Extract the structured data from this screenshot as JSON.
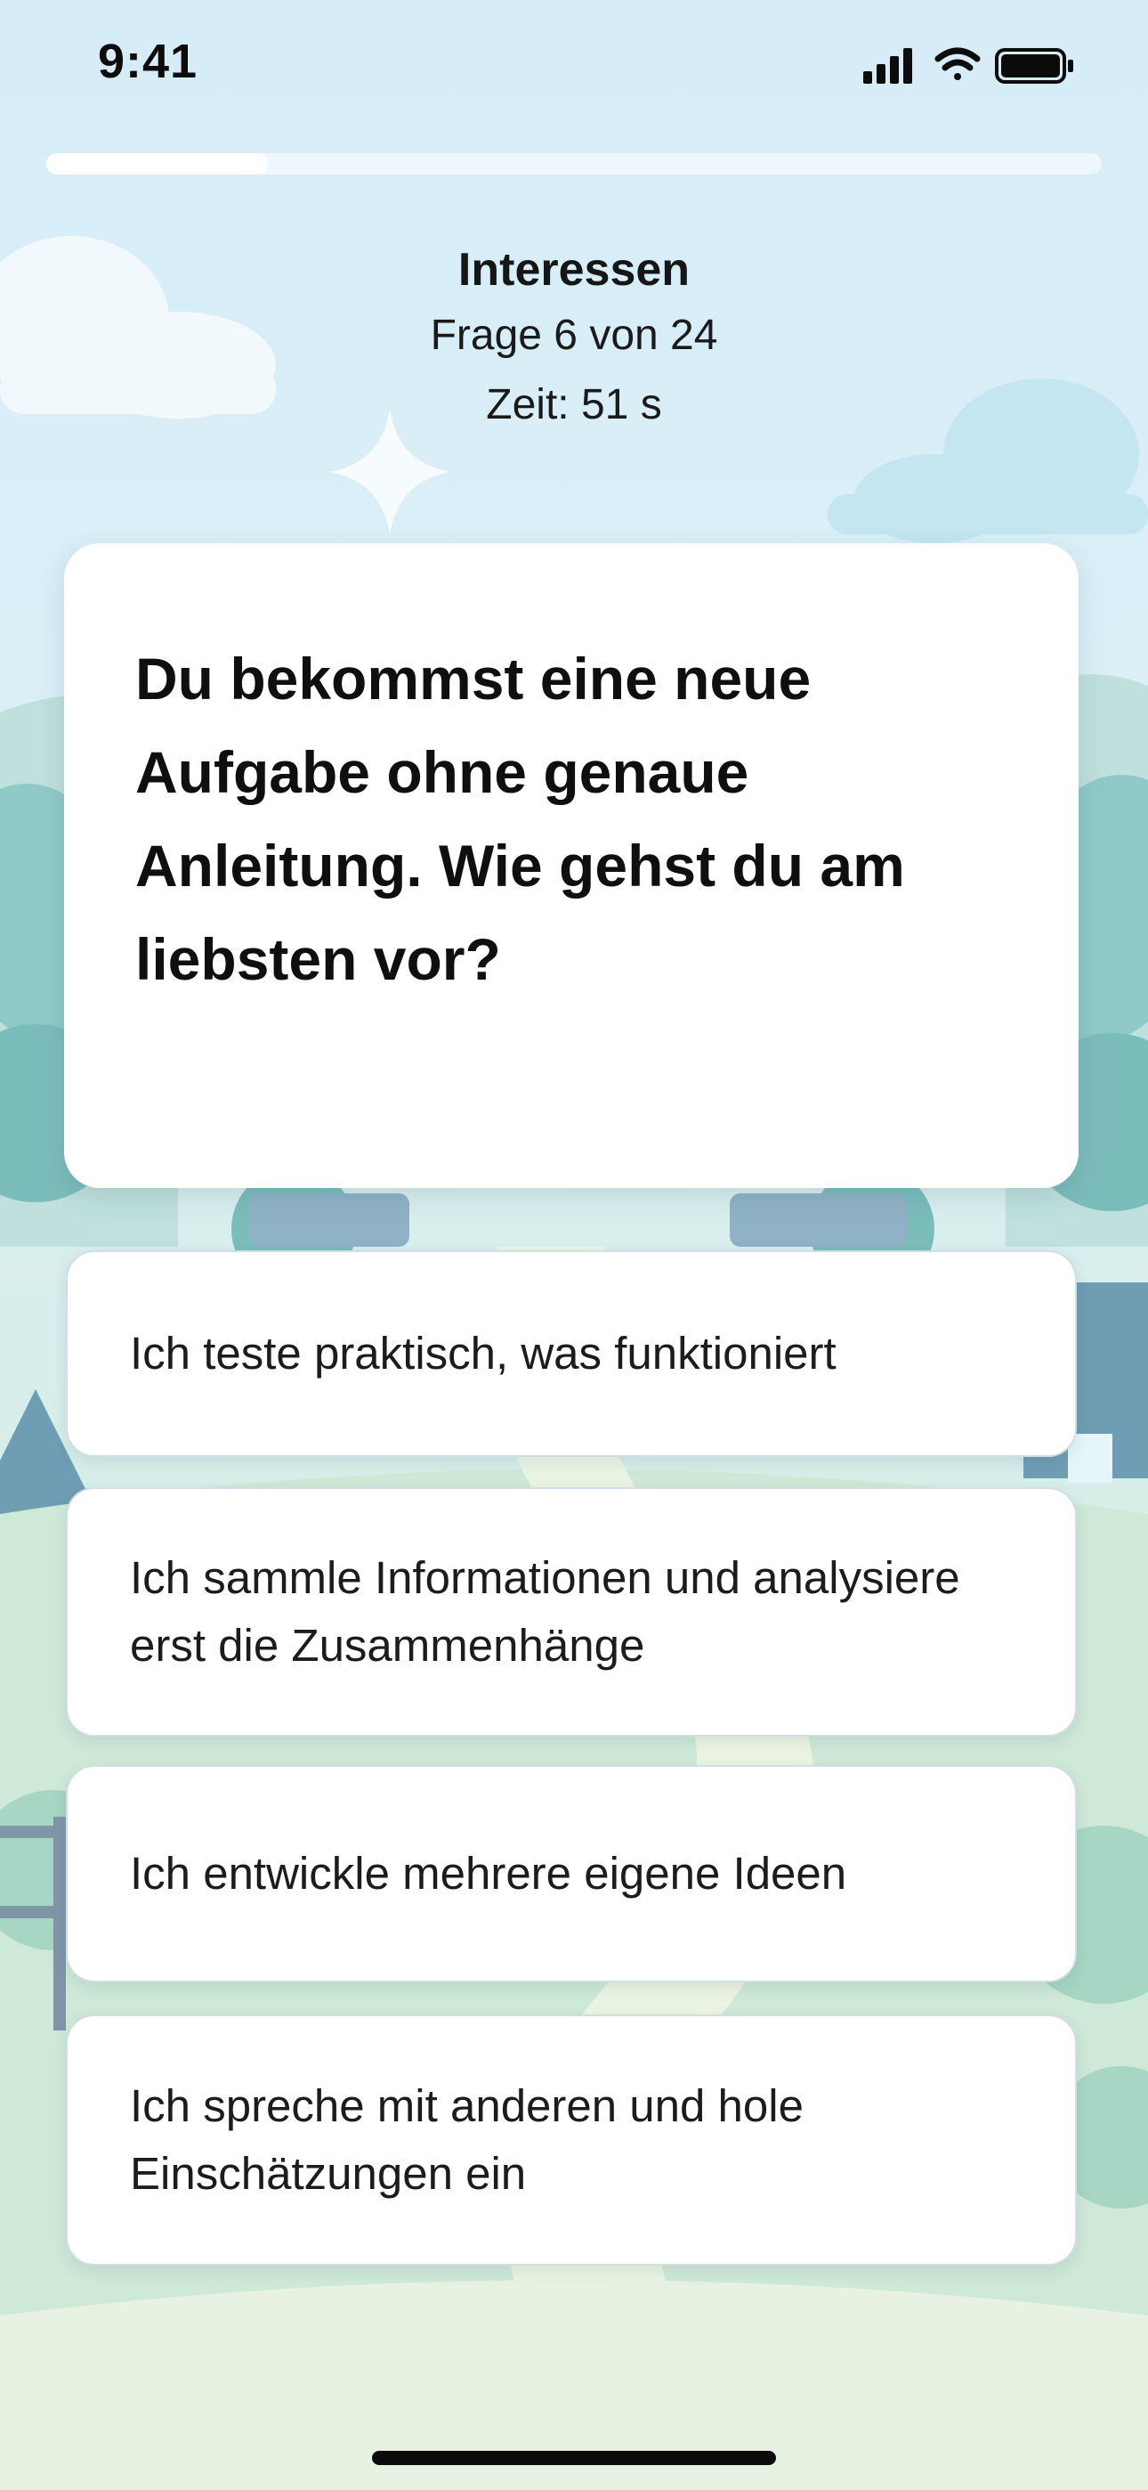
{
  "status_bar": {
    "time": "9:41",
    "icons": [
      "cellular-signal-icon",
      "wifi-icon",
      "battery-icon"
    ]
  },
  "progress": {
    "current": 6,
    "total": 24,
    "fraction": 0.21
  },
  "header": {
    "section_title": "Interessen",
    "question_counter": "Frage 6 von 24",
    "timer": "Zeit: 51 s"
  },
  "question": {
    "text": "Du bekommst eine neue Aufgabe ohne genaue Anleitung. Wie gehst du am liebsten vor?"
  },
  "answers": [
    {
      "label": "Ich teste praktisch, was funktioniert"
    },
    {
      "label": "Ich sammle Informationen und analysiere erst die Zusammenhänge"
    },
    {
      "label": "Ich entwickle mehrere eigene Ideen"
    },
    {
      "label": "Ich spreche mit anderen und hole Einschätzungen ein"
    }
  ],
  "colors": {
    "sky_top": "#d8eef8",
    "sky_bottom": "#e8f4ef",
    "card": "#ffffff",
    "text": "#111111",
    "tree_teal": "#7fc4c4",
    "house_blue": "#6f9db3"
  }
}
